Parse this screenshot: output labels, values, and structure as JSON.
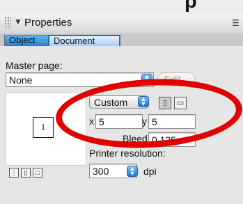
{
  "window": {
    "title_fragment": "p"
  },
  "palette": {
    "title": "Properties",
    "menu_icon": "panel-menu-icon"
  },
  "tabs": [
    {
      "label": "Object",
      "selected": true
    },
    {
      "label": "Document",
      "selected": false
    }
  ],
  "master_page": {
    "label": "Master page:",
    "value": "None",
    "edit_label": "Edit..."
  },
  "preview": {
    "page_number": "1"
  },
  "page_size": {
    "preset": "Custom",
    "x_label": "x",
    "x_value": "5",
    "y_label": "y",
    "y_value": "5",
    "bleed_label": "Bleed",
    "bleed_value": "0.125"
  },
  "printer": {
    "label": "Printer resolution:",
    "value": "300",
    "unit": "dpi"
  },
  "colors": {
    "accent": "#2b84d8",
    "annotation": "#e00000"
  }
}
